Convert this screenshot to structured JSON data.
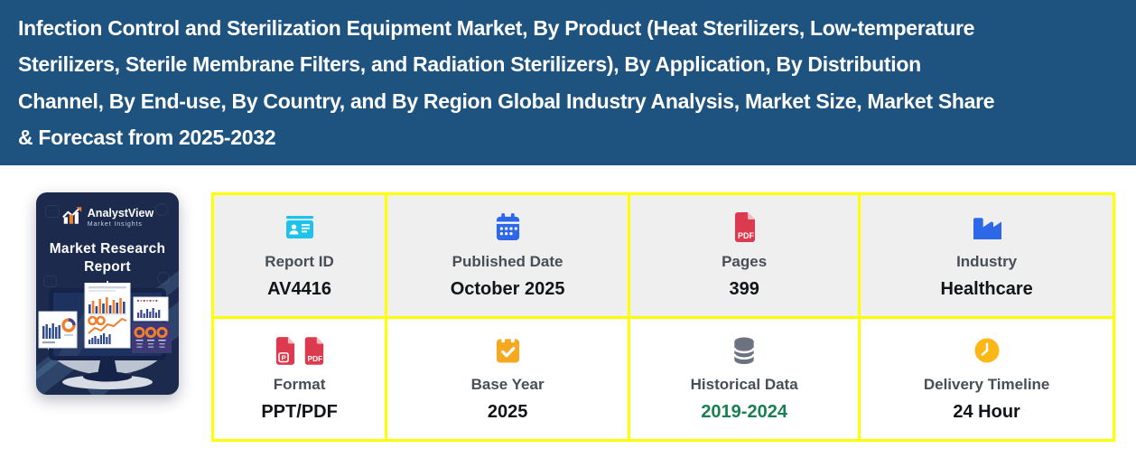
{
  "header": {
    "lines": [
      "Infection Control and Sterilization Equipment Market, By Product (Heat Sterilizers, Low-temperature",
      "Sterilizers, Sterile Membrane Filters, and Radiation Sterilizers), By Application, By Distribution",
      "Channel, By End-use, By Country, and By Region Global Industry Analysis, Market Size, Market Share",
      "& Forecast from 2025-2032"
    ]
  },
  "cover": {
    "brand": "AnalystView",
    "brand_sub": "Market Insights",
    "caption_line1": "Market Research",
    "caption_line2": "Report"
  },
  "meta": {
    "cells": [
      {
        "label": "Report ID",
        "value": "AV4416",
        "icon": "id-card-icon"
      },
      {
        "label": "Published Date",
        "value": "October 2025",
        "icon": "calendar-icon"
      },
      {
        "label": "Pages",
        "value": "399",
        "icon": "pdf-file-icon"
      },
      {
        "label": "Industry",
        "value": "Healthcare",
        "icon": "industry-icon"
      },
      {
        "label": "Format",
        "value": "PPT/PDF",
        "icon": "ppt-pdf-file-icons"
      },
      {
        "label": "Base Year",
        "value": "2025",
        "icon": "calendar-check-icon"
      },
      {
        "label": "Historical Data",
        "value": "2019-2024",
        "icon": "database-icon"
      },
      {
        "label": "Delivery Timeline",
        "value": "24 Hour",
        "icon": "clock-icon"
      }
    ]
  },
  "icons": {
    "pdf_label": "PDF",
    "ppt_label": "P"
  },
  "colors": {
    "header_bg": "#1F537F",
    "grid_border": "#FFFF00",
    "cell_top_bg": "#EFEFEF",
    "cell_bottom_bg": "#FFFFFF",
    "label_text": "#474E57",
    "value_text": "#111418",
    "historical_green": "#1A8052",
    "icon_cyan": "#1FC3EA",
    "icon_blue": "#2D68E8",
    "icon_red": "#DC3B4F",
    "icon_amber": "#F6A821",
    "icon_clock_amber": "#FBB817",
    "icon_gray": "#6B7280",
    "cover_bg": "#1C2B4D"
  }
}
